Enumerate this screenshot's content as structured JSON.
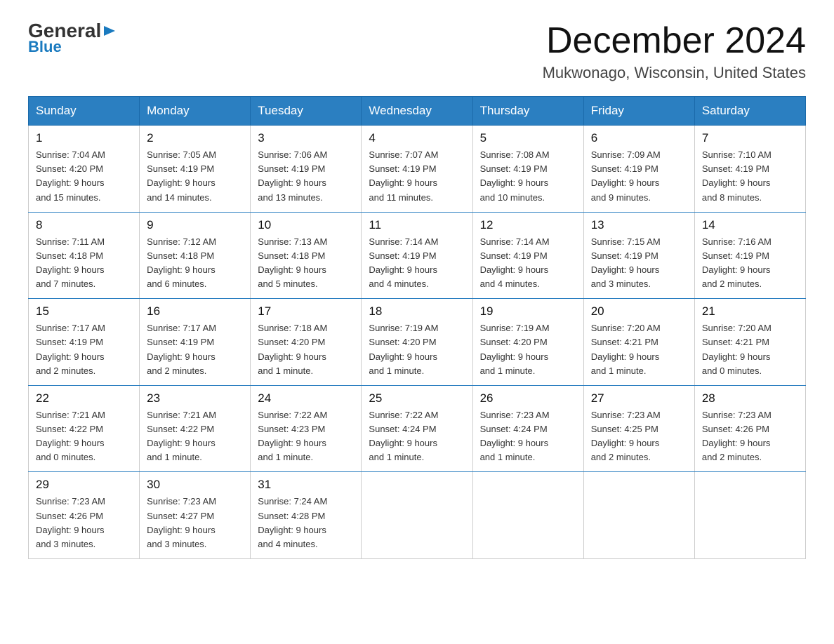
{
  "header": {
    "logo_general": "General",
    "logo_blue": "Blue",
    "month_title": "December 2024",
    "location": "Mukwonago, Wisconsin, United States"
  },
  "days_of_week": [
    "Sunday",
    "Monday",
    "Tuesday",
    "Wednesday",
    "Thursday",
    "Friday",
    "Saturday"
  ],
  "weeks": [
    [
      {
        "day": "1",
        "sunrise": "7:04 AM",
        "sunset": "4:20 PM",
        "daylight": "9 hours and 15 minutes."
      },
      {
        "day": "2",
        "sunrise": "7:05 AM",
        "sunset": "4:19 PM",
        "daylight": "9 hours and 14 minutes."
      },
      {
        "day": "3",
        "sunrise": "7:06 AM",
        "sunset": "4:19 PM",
        "daylight": "9 hours and 13 minutes."
      },
      {
        "day": "4",
        "sunrise": "7:07 AM",
        "sunset": "4:19 PM",
        "daylight": "9 hours and 11 minutes."
      },
      {
        "day": "5",
        "sunrise": "7:08 AM",
        "sunset": "4:19 PM",
        "daylight": "9 hours and 10 minutes."
      },
      {
        "day": "6",
        "sunrise": "7:09 AM",
        "sunset": "4:19 PM",
        "daylight": "9 hours and 9 minutes."
      },
      {
        "day": "7",
        "sunrise": "7:10 AM",
        "sunset": "4:19 PM",
        "daylight": "9 hours and 8 minutes."
      }
    ],
    [
      {
        "day": "8",
        "sunrise": "7:11 AM",
        "sunset": "4:18 PM",
        "daylight": "9 hours and 7 minutes."
      },
      {
        "day": "9",
        "sunrise": "7:12 AM",
        "sunset": "4:18 PM",
        "daylight": "9 hours and 6 minutes."
      },
      {
        "day": "10",
        "sunrise": "7:13 AM",
        "sunset": "4:18 PM",
        "daylight": "9 hours and 5 minutes."
      },
      {
        "day": "11",
        "sunrise": "7:14 AM",
        "sunset": "4:19 PM",
        "daylight": "9 hours and 4 minutes."
      },
      {
        "day": "12",
        "sunrise": "7:14 AM",
        "sunset": "4:19 PM",
        "daylight": "9 hours and 4 minutes."
      },
      {
        "day": "13",
        "sunrise": "7:15 AM",
        "sunset": "4:19 PM",
        "daylight": "9 hours and 3 minutes."
      },
      {
        "day": "14",
        "sunrise": "7:16 AM",
        "sunset": "4:19 PM",
        "daylight": "9 hours and 2 minutes."
      }
    ],
    [
      {
        "day": "15",
        "sunrise": "7:17 AM",
        "sunset": "4:19 PM",
        "daylight": "9 hours and 2 minutes."
      },
      {
        "day": "16",
        "sunrise": "7:17 AM",
        "sunset": "4:19 PM",
        "daylight": "9 hours and 2 minutes."
      },
      {
        "day": "17",
        "sunrise": "7:18 AM",
        "sunset": "4:20 PM",
        "daylight": "9 hours and 1 minute."
      },
      {
        "day": "18",
        "sunrise": "7:19 AM",
        "sunset": "4:20 PM",
        "daylight": "9 hours and 1 minute."
      },
      {
        "day": "19",
        "sunrise": "7:19 AM",
        "sunset": "4:20 PM",
        "daylight": "9 hours and 1 minute."
      },
      {
        "day": "20",
        "sunrise": "7:20 AM",
        "sunset": "4:21 PM",
        "daylight": "9 hours and 1 minute."
      },
      {
        "day": "21",
        "sunrise": "7:20 AM",
        "sunset": "4:21 PM",
        "daylight": "9 hours and 0 minutes."
      }
    ],
    [
      {
        "day": "22",
        "sunrise": "7:21 AM",
        "sunset": "4:22 PM",
        "daylight": "9 hours and 0 minutes."
      },
      {
        "day": "23",
        "sunrise": "7:21 AM",
        "sunset": "4:22 PM",
        "daylight": "9 hours and 1 minute."
      },
      {
        "day": "24",
        "sunrise": "7:22 AM",
        "sunset": "4:23 PM",
        "daylight": "9 hours and 1 minute."
      },
      {
        "day": "25",
        "sunrise": "7:22 AM",
        "sunset": "4:24 PM",
        "daylight": "9 hours and 1 minute."
      },
      {
        "day": "26",
        "sunrise": "7:23 AM",
        "sunset": "4:24 PM",
        "daylight": "9 hours and 1 minute."
      },
      {
        "day": "27",
        "sunrise": "7:23 AM",
        "sunset": "4:25 PM",
        "daylight": "9 hours and 2 minutes."
      },
      {
        "day": "28",
        "sunrise": "7:23 AM",
        "sunset": "4:26 PM",
        "daylight": "9 hours and 2 minutes."
      }
    ],
    [
      {
        "day": "29",
        "sunrise": "7:23 AM",
        "sunset": "4:26 PM",
        "daylight": "9 hours and 3 minutes."
      },
      {
        "day": "30",
        "sunrise": "7:23 AM",
        "sunset": "4:27 PM",
        "daylight": "9 hours and 3 minutes."
      },
      {
        "day": "31",
        "sunrise": "7:24 AM",
        "sunset": "4:28 PM",
        "daylight": "9 hours and 4 minutes."
      },
      null,
      null,
      null,
      null
    ]
  ]
}
